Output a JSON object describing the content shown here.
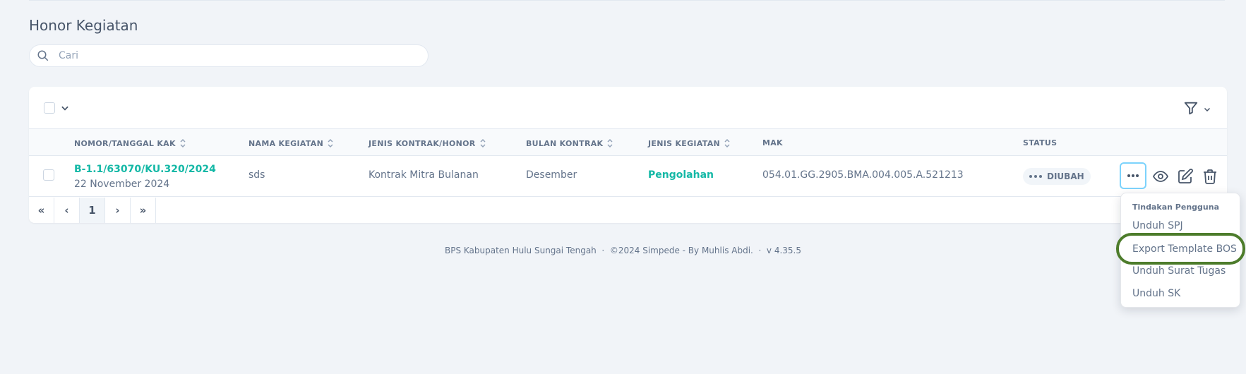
{
  "page": {
    "title": "Honor Kegiatan",
    "search_placeholder": "Cari"
  },
  "table": {
    "columns": [
      {
        "label": "NOMOR/TANGGAL KAK",
        "sortable": true
      },
      {
        "label": "NAMA KEGIATAN",
        "sortable": true
      },
      {
        "label": "JENIS KONTRAK/HONOR",
        "sortable": true
      },
      {
        "label": "BULAN KONTRAK",
        "sortable": true
      },
      {
        "label": "JENIS KEGIATAN",
        "sortable": true
      },
      {
        "label": "MAK",
        "sortable": false
      },
      {
        "label": "STATUS",
        "sortable": false
      }
    ],
    "rows": [
      {
        "nomor_kak": "B-1.1/63070/KU.320/2024",
        "tanggal_kak": "22 November 2024",
        "nama_kegiatan": "sds",
        "jenis_kontrak": "Kontrak Mitra Bulanan",
        "bulan_kontrak": "Desember",
        "jenis_kegiatan": "Pengolahan",
        "mak": "054.01.GG.2905.BMA.004.005.A.521213",
        "status": "DIUBAH"
      }
    ]
  },
  "pagination": {
    "first": "«",
    "prev": "‹",
    "current": "1",
    "next": "›",
    "last": "»"
  },
  "footer": {
    "text": "BPS Kabupaten Hulu Sungai Tengah  ·  ©2024 Simpede - By Muhlis Abdi.  ·  v 4.35.5"
  },
  "dropdown": {
    "title": "Tindakan Pengguna",
    "items": [
      "Unduh SPJ",
      "Export Template BOS",
      "Unduh Surat Tugas",
      "Unduh SK"
    ],
    "highlighted_index": 1
  },
  "colors": {
    "accent_teal": "#14b8a6",
    "highlight_ring": "#4d7c2b",
    "focus_ring": "#7dd3fc"
  }
}
